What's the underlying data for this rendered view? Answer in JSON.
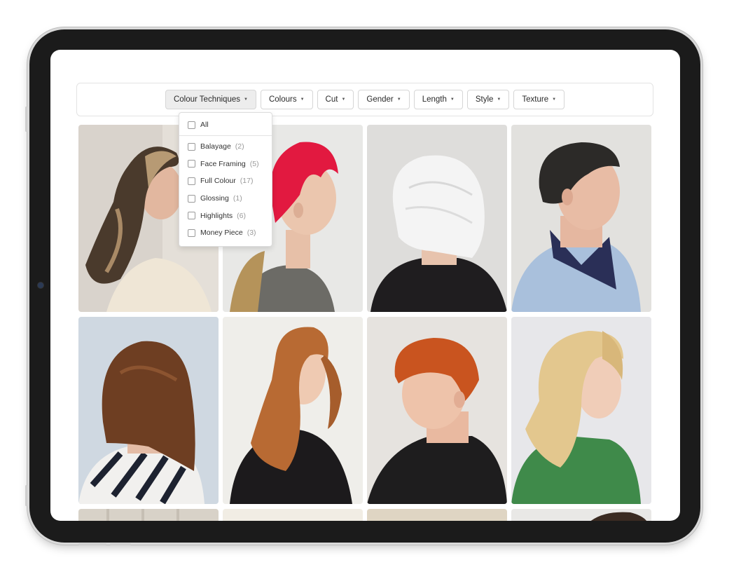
{
  "filters": [
    {
      "label": "Colour Techniques",
      "active": true
    },
    {
      "label": "Colours",
      "active": false
    },
    {
      "label": "Cut",
      "active": false
    },
    {
      "label": "Gender",
      "active": false
    },
    {
      "label": "Length",
      "active": false
    },
    {
      "label": "Style",
      "active": false
    },
    {
      "label": "Texture",
      "active": false
    }
  ],
  "dropdown": {
    "all_label": "All",
    "options": [
      {
        "label": "Balayage",
        "count": "(2)"
      },
      {
        "label": "Face Framing",
        "count": "(5)"
      },
      {
        "label": "Full Colour",
        "count": "(17)"
      },
      {
        "label": "Glossing",
        "count": "(1)"
      },
      {
        "label": "Highlights",
        "count": "(6)"
      },
      {
        "label": "Money Piece",
        "count": "(3)"
      }
    ]
  },
  "colors": {
    "device_bezel": "#1b1b1b",
    "active_filter_bg": "#ededed",
    "border": "#d6d6d6"
  },
  "gallery": {
    "photos": [
      {
        "icon": "photo-long-balayage-waves"
      },
      {
        "icon": "photo-red-pixie"
      },
      {
        "icon": "photo-white-bob"
      },
      {
        "icon": "photo-dark-short-cut"
      },
      {
        "icon": "photo-brown-blunt-bob"
      },
      {
        "icon": "photo-copper-long-layers"
      },
      {
        "icon": "photo-copper-crop"
      },
      {
        "icon": "photo-blonde-layers"
      }
    ]
  }
}
